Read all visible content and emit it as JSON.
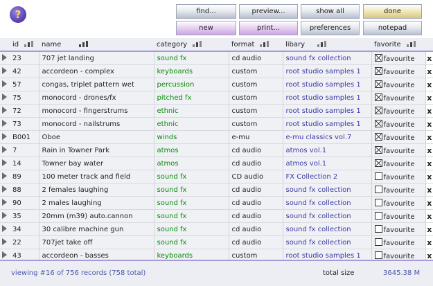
{
  "toolbar": {
    "help_label": "?",
    "find_label": "find...",
    "preview_label": "preview...",
    "show_all_label": "show all",
    "done_label": "done",
    "new_label": "new",
    "print_label": "print...",
    "preferences_label": "preferences",
    "notepad_label": "notepad"
  },
  "columns": {
    "id": "id",
    "name": "name",
    "category": "category",
    "format": "format",
    "library": "libary",
    "favorite": "favorite"
  },
  "rows": [
    {
      "id": "23",
      "name": "707 jet landing",
      "category": "sound fx",
      "format": "cd audio",
      "library": "sound fx collection",
      "favourite": true,
      "fav_label": "favourite",
      "delete": "x"
    },
    {
      "id": "42",
      "name": "accordeon - complex",
      "category": "keyboards",
      "format": "custom",
      "library": "root studio samples 1",
      "favourite": true,
      "fav_label": "favourite",
      "delete": "x"
    },
    {
      "id": "57",
      "name": "congas, triplet pattern wet",
      "category": "percussion",
      "format": "custom",
      "library": "root studio samples 1",
      "favourite": true,
      "fav_label": "favourite",
      "delete": "x"
    },
    {
      "id": "75",
      "name": "monocord - drones/fx",
      "category": "pitched fx",
      "format": "custom",
      "library": "root studio samples 1",
      "favourite": true,
      "fav_label": "favourite",
      "delete": "x"
    },
    {
      "id": "72",
      "name": "monocord - fingerstrums",
      "category": "ethnic",
      "format": "custom",
      "library": "root studio samples 1",
      "favourite": true,
      "fav_label": "favourite",
      "delete": "x"
    },
    {
      "id": "73",
      "name": "monocord - nailstrums",
      "category": "ethnic",
      "format": "custom",
      "library": "root studio samples 1",
      "favourite": true,
      "fav_label": "favourite",
      "delete": "x"
    },
    {
      "id": "B001",
      "name": "Oboe",
      "category": "winds",
      "format": "e-mu",
      "library": "e-mu classics vol.7",
      "favourite": true,
      "fav_label": "favourite",
      "delete": "x"
    },
    {
      "id": "7",
      "name": "Rain in Towner Park",
      "category": "atmos",
      "format": "cd audio",
      "library": "atmos vol.1",
      "favourite": true,
      "fav_label": "favourite",
      "delete": "x"
    },
    {
      "id": "14",
      "name": "Towner bay water",
      "category": "atmos",
      "format": "cd audio",
      "library": "atmos vol.1",
      "favourite": true,
      "fav_label": "favourite",
      "delete": "x"
    },
    {
      "id": "89",
      "name": "100 meter track and field",
      "category": "sound fx",
      "format": "CD audio",
      "library": "FX Collection 2",
      "favourite": false,
      "fav_label": "favourite",
      "delete": "x"
    },
    {
      "id": "88",
      "name": "2 females laughing",
      "category": "sound fx",
      "format": "cd audio",
      "library": "sound fx collection",
      "favourite": false,
      "fav_label": "favourite",
      "delete": "x"
    },
    {
      "id": "90",
      "name": "2 males laughing",
      "category": "sound fx",
      "format": "cd audio",
      "library": "sound fx collection",
      "favourite": false,
      "fav_label": "favourite",
      "delete": "x"
    },
    {
      "id": "35",
      "name": "20mm (m39) auto.cannon",
      "category": "sound fx",
      "format": "cd audio",
      "library": "sound fx collection",
      "favourite": false,
      "fav_label": "favourite",
      "delete": "x"
    },
    {
      "id": "34",
      "name": "30 calibre machine gun",
      "category": "sound fx",
      "format": "cd audio",
      "library": "sound fx collection",
      "favourite": false,
      "fav_label": "favourite",
      "delete": "x"
    },
    {
      "id": "22",
      "name": "707jet take off",
      "category": "sound fx",
      "format": "cd audio",
      "library": "sound fx collection",
      "favourite": false,
      "fav_label": "favourite",
      "delete": "x"
    },
    {
      "id": "43",
      "name": "accordeon - basses",
      "category": "keyboards",
      "format": "custom",
      "library": "root studio samples 1",
      "favourite": false,
      "fav_label": "favourite",
      "delete": "x"
    }
  ],
  "status": {
    "viewing": "viewing #16 of 756 records (758 total)",
    "total_size_label": "total size",
    "total_size_value": "3645.38 M"
  },
  "colors": {
    "category_text": "#0a8a0a",
    "library_text": "#3a3aa4",
    "delete_x": "#d21c1c",
    "header_underline": "#a69ad8"
  }
}
